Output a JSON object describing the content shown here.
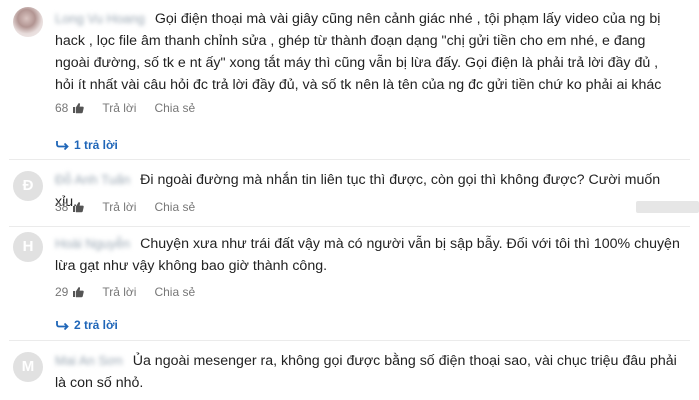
{
  "comments": [
    {
      "avatar_letter": "",
      "author": "Long Vu Hoang",
      "text": "Gọi điện thoại mà vài giây cũng nên cảnh giác nhé , tội phạm lấy video của ng bị hack , lọc file âm thanh chỉnh sửa , ghép từ thành đoạn dạng \"chị gửi tiền cho em nhé, e đang ngoài đường, số tk e nt ấy\" xong tắt máy thì cũng vẫn bị lừa đấy. Gọi điện là phải trả lời đầy đủ , hỏi ít nhất vài câu hỏi đc trả lời đầy đủ, và số tk nên là tên của ng đc gửi tiền chứ ko phải ai khác",
      "likes": "68",
      "reply_label": "Trả lời",
      "share_label": "Chia sẻ",
      "replies_label": "1 trả lời"
    },
    {
      "avatar_letter": "Đ",
      "author": "Đỗ Anh Tuấn",
      "text": "Đi ngoài đường mà nhắn tin liên tục thì được, còn gọi thì không được? Cười muốn xỉu.",
      "likes": "38",
      "reply_label": "Trả lời",
      "share_label": "Chia sẻ"
    },
    {
      "avatar_letter": "H",
      "author": "Hoài Nguyễn",
      "text": "Chuyện xưa như trái đất vậy mà có người vẫn bị sập bẫy. Đối với tôi thì 100% chuyện lừa gạt như vậy không bao giờ thành công.",
      "likes": "29",
      "reply_label": "Trả lời",
      "share_label": "Chia sẻ",
      "replies_label": "2 trả lời"
    },
    {
      "avatar_letter": "M",
      "author": "Mai An Sơn",
      "text": "Ủa ngoài mesenger ra, không gọi được bằng số điện thoại sao, vài chục triệu đâu phải là con số nhỏ."
    }
  ],
  "colors": {
    "link": "#1f66b8",
    "meta": "#777777",
    "avatar_bg": "#e1e1e1"
  }
}
